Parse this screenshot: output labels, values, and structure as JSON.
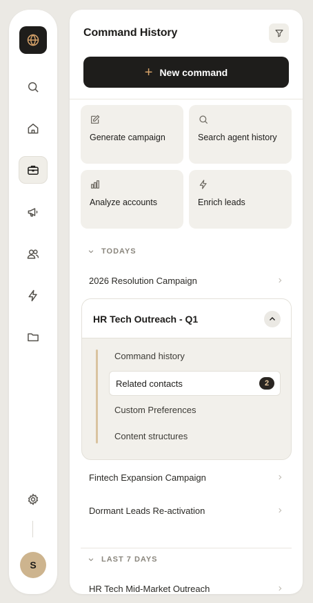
{
  "panel": {
    "title": "Command History",
    "new_command_label": "New command"
  },
  "quick_actions": [
    {
      "label": "Generate campaign",
      "icon": "edit-icon"
    },
    {
      "label": "Search agent history",
      "icon": "search-icon"
    },
    {
      "label": "Analyze accounts",
      "icon": "bar-chart-icon"
    },
    {
      "label": "Enrich leads",
      "icon": "lightning-icon"
    }
  ],
  "sections": {
    "today": {
      "header": "TODAYS",
      "items": [
        "2026 Resolution Campaign",
        "Fintech Expansion Campaign",
        "Dormant Leads Re-activation"
      ]
    },
    "last7": {
      "header": "LAST 7 DAYS",
      "items": [
        "HR Tech Mid-Market Outreach"
      ]
    }
  },
  "expanded_item": {
    "title": "HR Tech Outreach - Q1",
    "sub_items": [
      "Command history",
      "Related contacts",
      "Custom Preferences",
      "Content structures"
    ],
    "related_contacts_count": "2"
  },
  "rail": {
    "avatar_initial": "S",
    "icons": [
      "globe-icon",
      "search-icon",
      "home-icon",
      "briefcase-icon",
      "megaphone-icon",
      "users-icon",
      "lightning-icon",
      "folder-icon",
      "settings-icon"
    ]
  },
  "colors": {
    "accent": "#d7a36a",
    "dark": "#1e1d1b",
    "card_bg": "#f2f0eb",
    "avatar_bg": "#cdb48e"
  }
}
